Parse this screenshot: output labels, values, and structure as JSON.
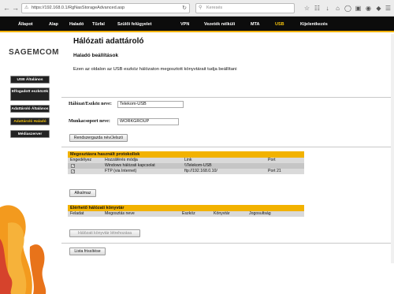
{
  "browser": {
    "url": "https://192.168.0.1/RgNasStorageAdvanced.asp",
    "search_placeholder": "Keresés"
  },
  "topnav": {
    "items": [
      "Állapot",
      "Alap",
      "Haladó",
      "Tűzfal",
      "Szülői felügyelet",
      "VPN",
      "Vezeték nélküli",
      "MTA",
      "USB",
      "Kijelentkezés"
    ],
    "active": "USB"
  },
  "sidebar": {
    "logo": "SAGEMCOM",
    "items": [
      {
        "label": "USB Általános"
      },
      {
        "label": "Elfogadott eszközök"
      },
      {
        "label": "Adattároló Általános"
      },
      {
        "label": "Adattároló Haladó"
      },
      {
        "label": "Médiaszerver"
      }
    ]
  },
  "main": {
    "title": "Hálózati adattároló",
    "subtitle": "Haladó beállítások",
    "description": "Ezen az oldalon az USB eszköz hálózaton megosztott könyvtárait tudja beállítani",
    "host_label": "Hálózat/Eszköz neve:",
    "host_value": "Telekom-USB",
    "workgroup_label": "Munkacsoport neve:",
    "workgroup_value": "WORKGROUP",
    "default_button": "Rendszergazda név/Jelszó"
  },
  "protocols": {
    "heading": "Megosztásra használt protokollok",
    "columns": [
      "Engedélyez",
      "Hozzáférés módja",
      "Link",
      "Port"
    ],
    "rows": [
      {
        "enabled": true,
        "mode": "Windows hálózati kapcsolat",
        "link": "\\\\Telekom-USB",
        "port": ""
      },
      {
        "enabled": true,
        "mode": "FTP (via Internet)",
        "link": "ftp://192.168.0.10/",
        "port": "Port 21"
      }
    ],
    "apply_button": "Alkalmaz"
  },
  "shares": {
    "heading": "Elérhető hálózati könyvtár",
    "columns": [
      "Feladat",
      "Megosztás neve",
      "Eszköz",
      "Könyvtár",
      "Jogosultság"
    ],
    "create_button": "Hálózati könyvtár létrehozása",
    "refresh_button": "Lista frissítése"
  },
  "colors": {
    "accent": "#f2b200",
    "nav_bg": "#0c0c0c"
  }
}
